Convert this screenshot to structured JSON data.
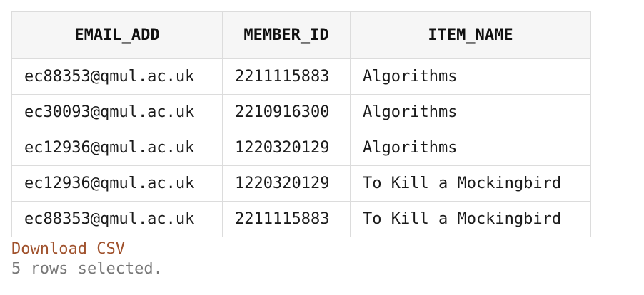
{
  "table": {
    "columns": [
      "EMAIL_ADD",
      "MEMBER_ID",
      "ITEM_NAME"
    ],
    "rows": [
      [
        "ec88353@qmul.ac.uk",
        "2211115883",
        "Algorithms"
      ],
      [
        "ec30093@qmul.ac.uk",
        "2210916300",
        "Algorithms"
      ],
      [
        "ec12936@qmul.ac.uk",
        "1220320129",
        "Algorithms"
      ],
      [
        "ec12936@qmul.ac.uk",
        "1220320129",
        "To Kill a Mockingbird"
      ],
      [
        "ec88353@qmul.ac.uk",
        "2211115883",
        "To Kill a Mockingbird"
      ]
    ]
  },
  "footer": {
    "download_label": "Download CSV",
    "status_text": "5 rows selected."
  },
  "colors": {
    "link": "#a0522d",
    "status": "#777777",
    "header_bg": "#f6f6f6",
    "border": "#dcdcdc"
  }
}
